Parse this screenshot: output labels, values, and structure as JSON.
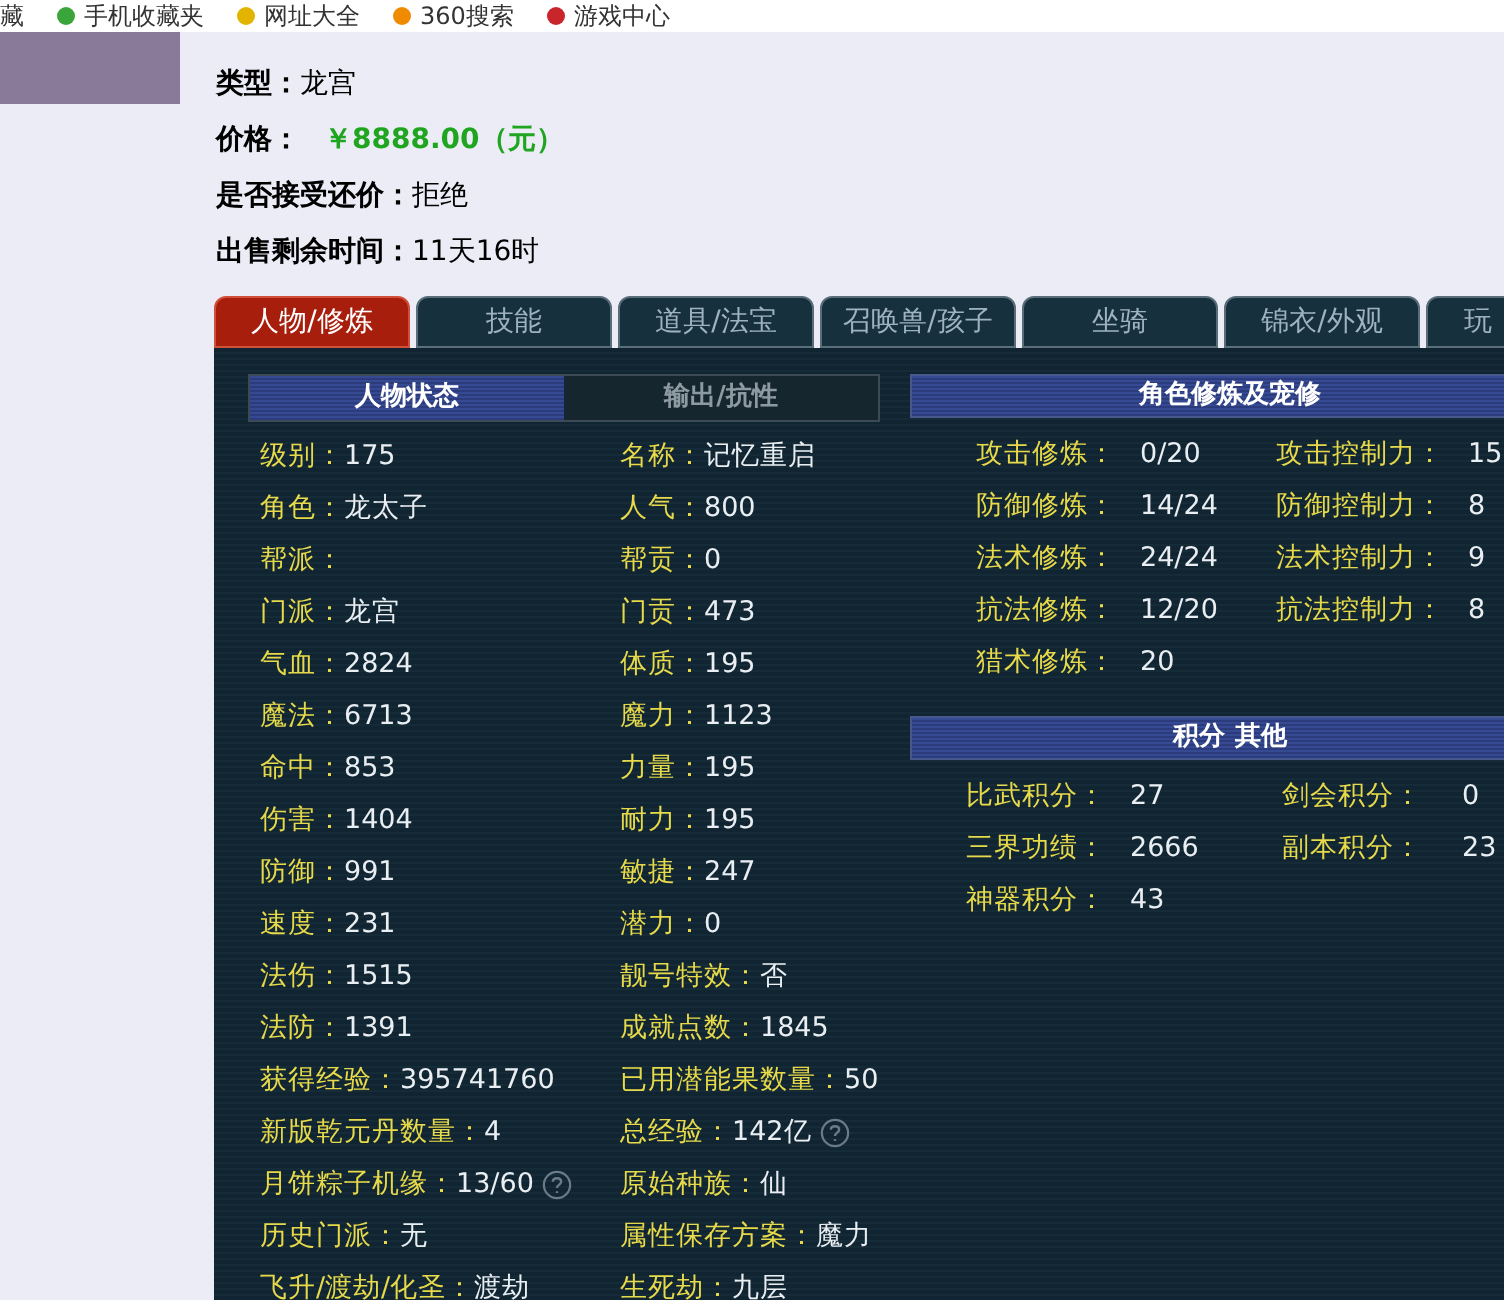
{
  "bookmarks": [
    {
      "label": "藏"
    },
    {
      "label": "手机收藏夹"
    },
    {
      "label": "网址大全"
    },
    {
      "label": "360搜索"
    },
    {
      "label": "游戏中心"
    }
  ],
  "info": [
    {
      "label": "类型：",
      "value": "龙宫",
      "kind": "plain"
    },
    {
      "label": "价格：",
      "value": "￥8888.00（元）",
      "kind": "price"
    },
    {
      "label": "是否接受还价：",
      "value": "拒绝",
      "kind": "plain"
    },
    {
      "label": "出售剩余时间：",
      "value": "11天16时",
      "kind": "plain"
    }
  ],
  "tabs": [
    {
      "label": "人物/修炼",
      "selected": true
    },
    {
      "label": "技能",
      "selected": false
    },
    {
      "label": "道具/法宝",
      "selected": false
    },
    {
      "label": "召唤兽/孩子",
      "selected": false
    },
    {
      "label": "坐骑",
      "selected": false
    },
    {
      "label": "锦衣/外观",
      "selected": false
    },
    {
      "label": "玩",
      "selected": false
    }
  ],
  "left_section": {
    "subtabs": [
      {
        "label": "人物状态",
        "selected": true
      },
      {
        "label": "输出/抗性",
        "selected": false
      }
    ],
    "stats": [
      {
        "label": "级别：",
        "value": "175",
        "help": false
      },
      {
        "label": "名称：",
        "value": "记忆重启",
        "help": false
      },
      {
        "label": "角色：",
        "value": "龙太子",
        "help": false
      },
      {
        "label": "人气：",
        "value": "800",
        "help": false
      },
      {
        "label": "帮派：",
        "help": false
      },
      {
        "label": "帮贡：",
        "value": "0",
        "help": false
      },
      {
        "label": "门派：",
        "value": "龙宫",
        "help": false
      },
      {
        "label": "门贡：",
        "value": "473",
        "help": false
      },
      {
        "label": "气血：",
        "value": "2824",
        "help": false
      },
      {
        "label": "体质：",
        "value": "195",
        "help": false
      },
      {
        "label": "魔法：",
        "value": "6713",
        "help": false
      },
      {
        "label": "魔力：",
        "value": "1123",
        "help": false
      },
      {
        "label": "命中：",
        "value": "853",
        "help": false
      },
      {
        "label": "力量：",
        "value": "195",
        "help": false
      },
      {
        "label": "伤害：",
        "value": "1404",
        "help": false
      },
      {
        "label": "耐力：",
        "value": "195",
        "help": false
      },
      {
        "label": "防御：",
        "value": "991",
        "help": false
      },
      {
        "label": "敏捷：",
        "value": "247",
        "help": false
      },
      {
        "label": "速度：",
        "value": "231",
        "help": false
      },
      {
        "label": "潜力：",
        "value": "0",
        "help": false
      },
      {
        "label": "法伤：",
        "value": "1515",
        "help": false
      },
      {
        "label": "靓号特效：",
        "value": "否",
        "help": false
      },
      {
        "label": "法防：",
        "value": "1391",
        "help": false
      },
      {
        "label": "成就点数：",
        "value": "1845",
        "help": false
      },
      {
        "label": "获得经验：",
        "value": "395741760",
        "help": false
      },
      {
        "label": "已用潜能果数量：",
        "value": "50",
        "help": false
      },
      {
        "label": "新版乾元丹数量：",
        "value": "4",
        "help": false
      },
      {
        "label": "总经验：",
        "value": "142亿",
        "help": true
      },
      {
        "label": "月饼粽子机缘：",
        "value": "13/60",
        "help": true
      },
      {
        "label": "原始种族：",
        "value": "仙",
        "help": false
      },
      {
        "label": "历史门派：",
        "value": "无",
        "help": false
      },
      {
        "label": "属性保存方案：",
        "value": "魔力",
        "help": false
      },
      {
        "label": "飞升/渡劫/化圣：",
        "value": "渡劫",
        "help": false
      },
      {
        "label": "生死劫：",
        "value": "九层",
        "help": false
      }
    ]
  },
  "cultivation": {
    "title": "角色修炼及宠修",
    "rows": [
      {
        "label": "攻击修炼：",
        "value": "0/20"
      },
      {
        "label": "攻击控制力：",
        "value": "15"
      },
      {
        "label": "防御修炼：",
        "value": "14/24"
      },
      {
        "label": "防御控制力：",
        "value": "8"
      },
      {
        "label": "法术修炼：",
        "value": "24/24"
      },
      {
        "label": "法术控制力：",
        "value": "9"
      },
      {
        "label": "抗法修炼：",
        "value": "12/20"
      },
      {
        "label": "抗法控制力：",
        "value": "8"
      },
      {
        "label": "猎术修炼：",
        "value": "20"
      }
    ]
  },
  "points": {
    "title": "积分 其他",
    "rows": [
      {
        "label": "比武积分：",
        "value": "27"
      },
      {
        "label": "剑会积分：",
        "value": "0"
      },
      {
        "label": "三界功绩：",
        "value": "2666"
      },
      {
        "label": "副本积分：",
        "value": "23"
      },
      {
        "label": "神器积分：",
        "value": "43"
      }
    ]
  }
}
